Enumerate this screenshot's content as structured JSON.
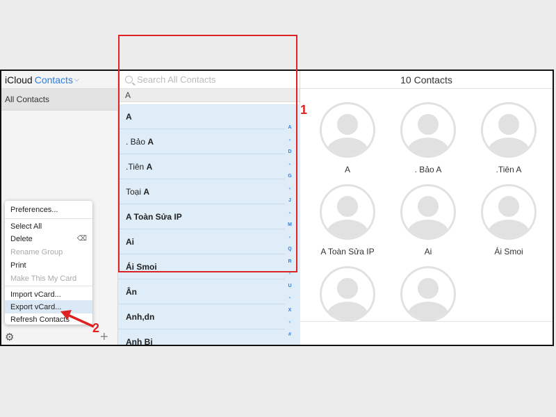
{
  "sidebar": {
    "brand": "iCloud",
    "app": "Contacts",
    "group": "All Contacts"
  },
  "menu": {
    "items": [
      {
        "label": "Preferences...",
        "disabled": false
      },
      {
        "label": "Select All",
        "disabled": false
      },
      {
        "label": "Delete",
        "disabled": false
      },
      {
        "label": "Rename Group",
        "disabled": true
      },
      {
        "label": "Print",
        "disabled": false
      },
      {
        "label": "Make This My Card",
        "disabled": true
      },
      {
        "label": "Import vCard...",
        "disabled": false
      },
      {
        "label": "Export vCard...",
        "disabled": false,
        "highlighted": true
      },
      {
        "label": "Refresh Contacts",
        "disabled": false
      }
    ]
  },
  "list": {
    "search_placeholder": "Search All Contacts",
    "section": "A",
    "rows": [
      {
        "pre": "",
        "bold": "A"
      },
      {
        "pre": ". Bảo ",
        "bold": "A"
      },
      {
        "pre": ".Tiên ",
        "bold": "A"
      },
      {
        "pre": "Toại ",
        "bold": "A"
      },
      {
        "pre": "",
        "bold": "A Toàn Sửa IP"
      },
      {
        "pre": "",
        "bold": "Ai"
      },
      {
        "pre": "",
        "bold": "Ái Smoi"
      },
      {
        "pre": "",
        "bold": "Ân"
      },
      {
        "pre": "",
        "bold": "Anh,dn"
      },
      {
        "pre": "",
        "bold": "Anh Bi"
      }
    ],
    "index": [
      "A",
      "•",
      "D",
      "•",
      "G",
      "•",
      "J",
      "•",
      "M",
      "•",
      "Q",
      "R",
      "•",
      "U",
      "•",
      "X",
      "•",
      "#"
    ]
  },
  "detail": {
    "count_label": "10 Contacts",
    "cards": [
      "A",
      ". Bảo A",
      ".Tiên A",
      "A Toàn Sửa IP",
      "Ai",
      "Ái Smoi",
      "",
      ""
    ]
  },
  "annotations": {
    "one": "1",
    "two": "2"
  },
  "colors": {
    "accent": "#2b7de0",
    "highlight": "#deedf8",
    "annotation": "#dd2222"
  }
}
